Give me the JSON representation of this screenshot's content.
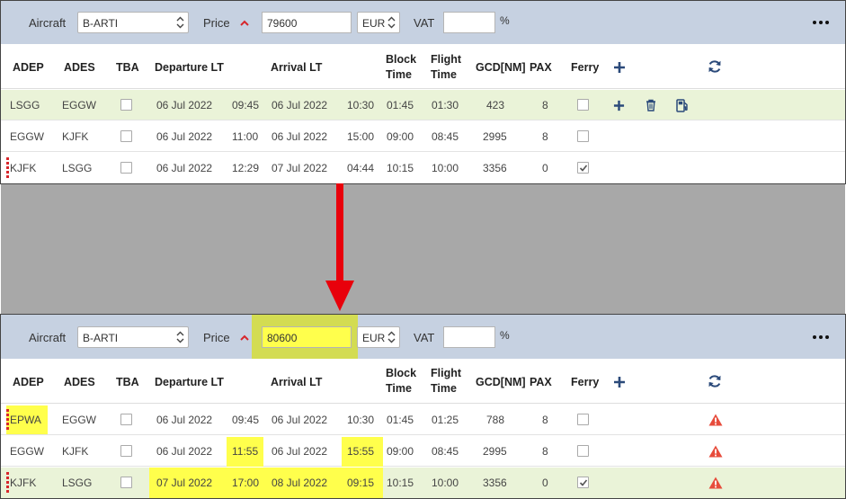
{
  "top": {
    "toolbar": {
      "aircraft_label": "Aircraft",
      "aircraft_value": "B-ARTI",
      "price_label": "Price",
      "price_value": "79600",
      "currency": "EUR",
      "vat_label": "VAT",
      "vat_value": "",
      "percent": "%"
    },
    "rows": [
      {
        "adep": "LSGG",
        "ades": "EGGW",
        "dep_date": "06 Jul 2022",
        "dep_time": "09:45",
        "arr_date": "06 Jul 2022",
        "arr_time": "10:30",
        "block": "01:45",
        "flight": "01:30",
        "gcd": "423",
        "pax": "8",
        "ferry": false
      },
      {
        "adep": "EGGW",
        "ades": "KJFK",
        "dep_date": "06 Jul 2022",
        "dep_time": "11:00",
        "arr_date": "06 Jul 2022",
        "arr_time": "15:00",
        "block": "09:00",
        "flight": "08:45",
        "gcd": "2995",
        "pax": "8",
        "ferry": false
      },
      {
        "adep": "KJFK",
        "ades": "LSGG",
        "dep_date": "06 Jul 2022",
        "dep_time": "12:29",
        "arr_date": "07 Jul 2022",
        "arr_time": "04:44",
        "block": "10:15",
        "flight": "10:00",
        "gcd": "3356",
        "pax": "0",
        "ferry": true
      }
    ]
  },
  "bottom": {
    "toolbar": {
      "aircraft_label": "Aircraft",
      "aircraft_value": "B-ARTI",
      "price_label": "Price",
      "price_value": "80600",
      "currency": "EUR",
      "vat_label": "VAT",
      "vat_value": "",
      "percent": "%"
    },
    "rows": [
      {
        "adep": "EPWA",
        "ades": "EGGW",
        "dep_date": "06 Jul 2022",
        "dep_time": "09:45",
        "arr_date": "06 Jul 2022",
        "arr_time": "10:30",
        "block": "01:45",
        "flight": "01:25",
        "gcd": "788",
        "pax": "8",
        "ferry": false
      },
      {
        "adep": "EGGW",
        "ades": "KJFK",
        "dep_date": "06 Jul 2022",
        "dep_time": "11:55",
        "arr_date": "06 Jul 2022",
        "arr_time": "15:55",
        "block": "09:00",
        "flight": "08:45",
        "gcd": "2995",
        "pax": "8",
        "ferry": false
      },
      {
        "adep": "KJFK",
        "ades": "LSGG",
        "dep_date": "07 Jul 2022",
        "dep_time": "17:00",
        "arr_date": "08 Jul 2022",
        "arr_time": "09:15",
        "block": "10:15",
        "flight": "10:00",
        "gcd": "3356",
        "pax": "0",
        "ferry": true
      }
    ]
  },
  "columns": {
    "adep": "ADEP",
    "ades": "ADES",
    "tba": "TBA",
    "departure": "Departure LT",
    "arrival": "Arrival LT",
    "block_1": "Block",
    "block_2": "Time",
    "flight_1": "Flight",
    "flight_2": "Time",
    "gcd": "GCD[NM]",
    "pax": "PAX",
    "ferry": "Ferry"
  },
  "icons": {
    "add": "plus-icon",
    "refresh": "refresh-icon",
    "delete": "trash-icon",
    "fuel": "fuel-pump-icon",
    "warning": "warning-icon",
    "menu": "more-dots-icon"
  },
  "colors": {
    "toolbar_bg": "#c6d1e1",
    "accent_blue": "#2b4a7a",
    "highlight_yellow": "#ffff4c",
    "row_green": "#eaf3d8",
    "warning_red": "#e74c3c",
    "arrow_red": "#e8000b"
  }
}
